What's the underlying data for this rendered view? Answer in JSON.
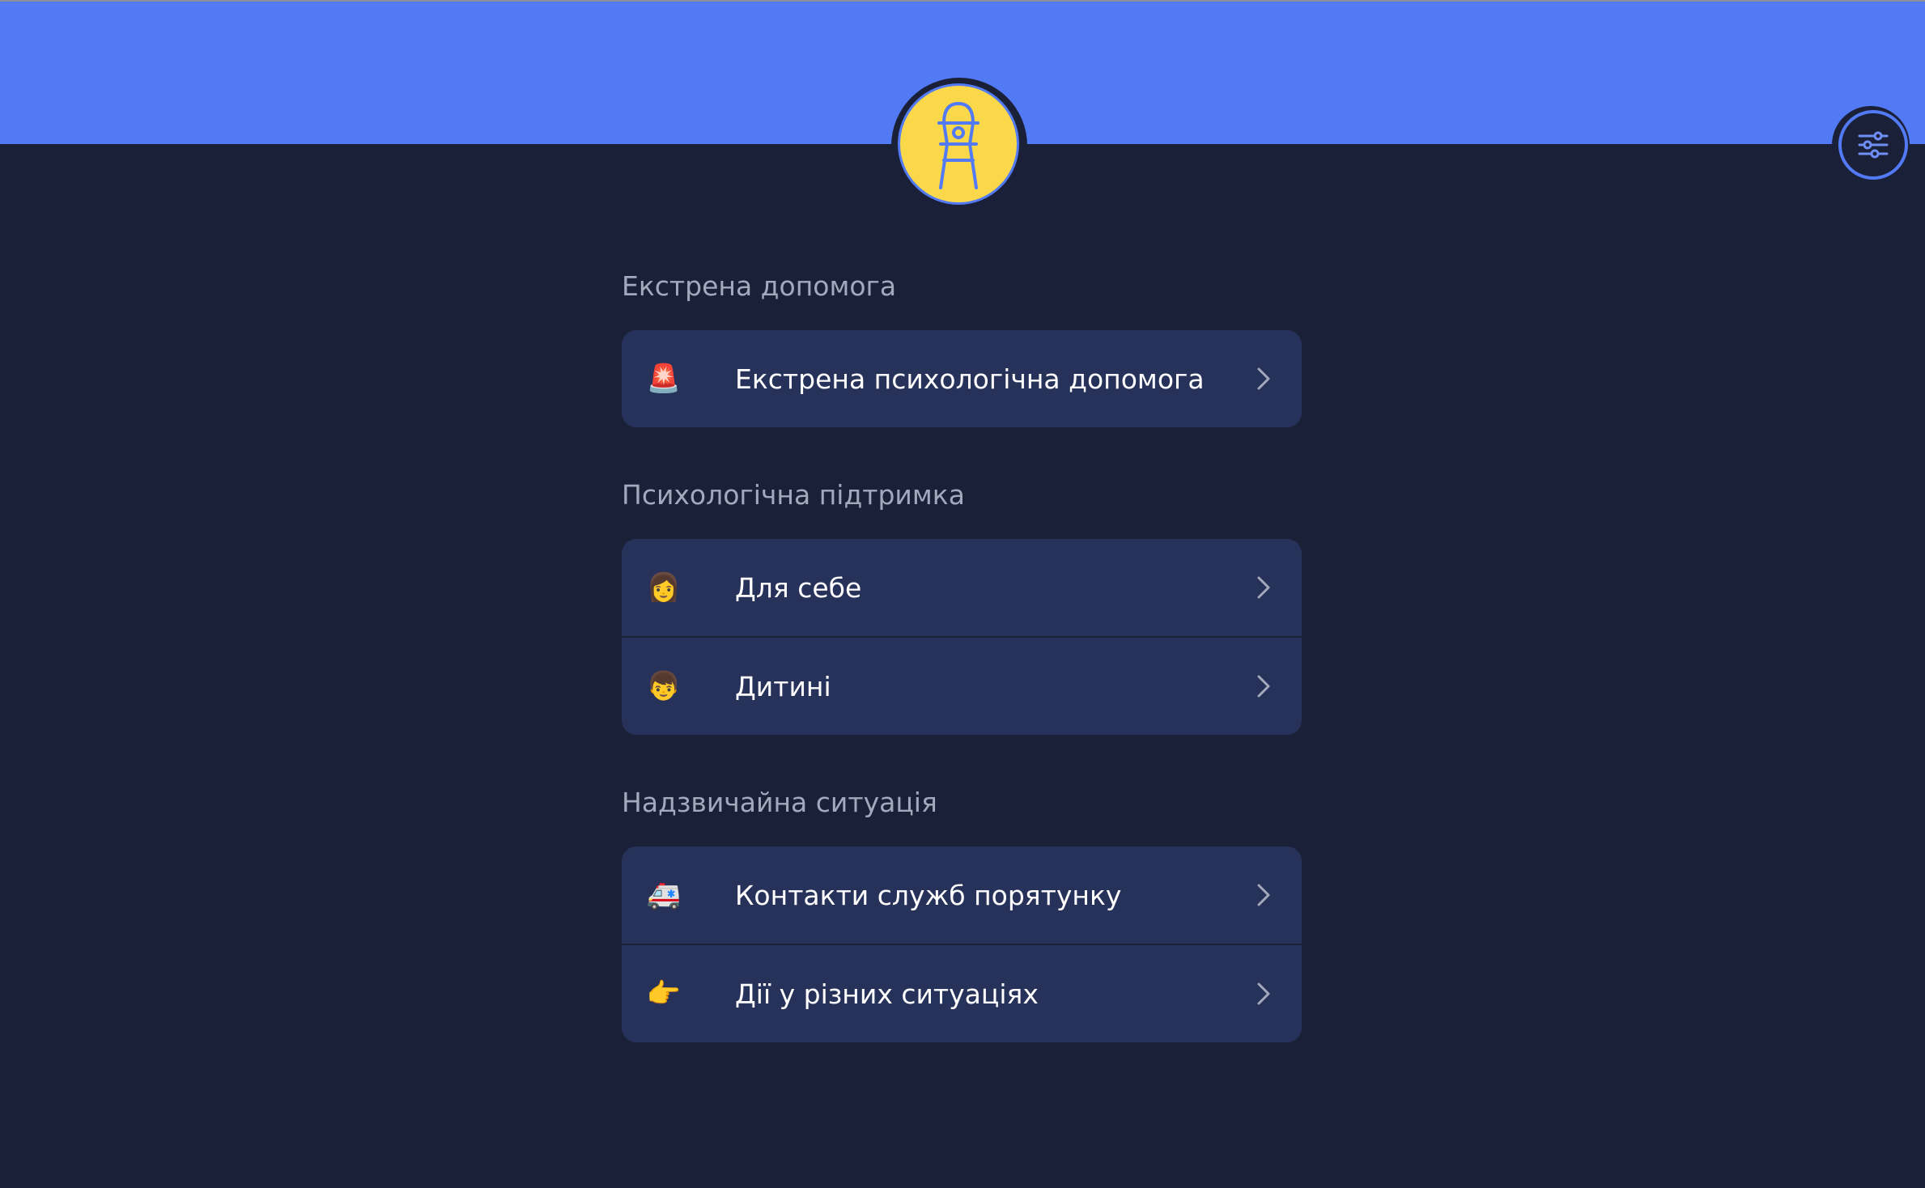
{
  "header": {
    "logo_icon": "lighthouse-icon",
    "filter_icon": "sliders-icon"
  },
  "colors": {
    "header_bg": "#527af5",
    "page_bg": "#1b2039",
    "card_bg": "#27325a",
    "logo_bg": "#fbd84a",
    "section_title": "#a3a8bd",
    "row_text": "#ffffff"
  },
  "sections": [
    {
      "title": "Екстрена допомога",
      "items": [
        {
          "icon": "🚨",
          "icon_name": "siren-icon",
          "label": "Екстрена психологічна допомога"
        }
      ]
    },
    {
      "title": "Психологічна підтримка",
      "items": [
        {
          "icon": "👩",
          "icon_name": "woman-icon",
          "label": "Для себе"
        },
        {
          "icon": "👦",
          "icon_name": "boy-icon",
          "label": "Дитині"
        }
      ]
    },
    {
      "title": "Надзвичайна ситуація",
      "items": [
        {
          "icon": "🚑",
          "icon_name": "ambulance-icon",
          "label": "Контакти служб порятунку"
        },
        {
          "icon": "👉",
          "icon_name": "pointing-hand-icon",
          "label": "Дії у різних ситуаціях"
        }
      ]
    }
  ]
}
